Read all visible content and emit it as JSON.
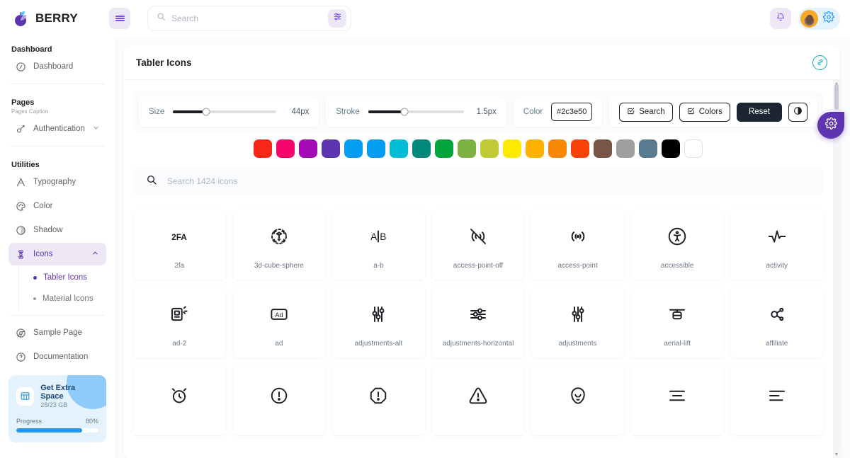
{
  "app": {
    "brand": "BERRY"
  },
  "topbar": {
    "menu_toggle": "menu-toggle",
    "search_placeholder": "Search",
    "search_value": "",
    "filter_label": "filter",
    "notifications_label": "notifications",
    "settings_label": "settings"
  },
  "sidebar": {
    "sections": [
      {
        "caption": "Dashboard",
        "subcaption": ""
      },
      {
        "caption": "Pages",
        "subcaption": "Pages Caption"
      },
      {
        "caption": "Utilities",
        "subcaption": ""
      }
    ],
    "dashboard_item": {
      "label": "Dashboard",
      "icon": "dashboard-icon"
    },
    "authentication_item": {
      "label": "Authentication",
      "icon": "key-icon"
    },
    "utilities": [
      {
        "label": "Typography",
        "icon": "typography-icon"
      },
      {
        "label": "Color",
        "icon": "palette-icon"
      },
      {
        "label": "Shadow",
        "icon": "shadow-icon"
      }
    ],
    "icons_item": {
      "label": "Icons",
      "icon": "icons-icon"
    },
    "icons_children": [
      {
        "label": "Tabler Icons",
        "active": true
      },
      {
        "label": "Material Icons",
        "active": false
      }
    ],
    "footer_items": [
      {
        "label": "Sample Page",
        "icon": "chrome-icon"
      },
      {
        "label": "Documentation",
        "icon": "help-icon"
      }
    ],
    "upsell": {
      "title": "Get Extra Space",
      "subtitle": "28/23 GB",
      "progress_label": "Progress",
      "progress_value": "80%",
      "progress_percent": 80,
      "icon": "table-icon"
    }
  },
  "page": {
    "title": "Tabler Icons",
    "link_icon": "link-icon"
  },
  "toolbar": {
    "size": {
      "label": "Size",
      "value": "44px",
      "percent": 32
    },
    "stroke": {
      "label": "Stroke",
      "value": "1.5px",
      "percent": 38
    },
    "color": {
      "label": "Color",
      "value": "#2c3e50"
    },
    "buttons": [
      {
        "label": "Search",
        "icon": "checkbox-icon",
        "style": "outline"
      },
      {
        "label": "Colors",
        "icon": "checkbox-icon",
        "style": "outline"
      },
      {
        "label": "Reset",
        "icon": "",
        "style": "dark"
      }
    ],
    "contrast_button": {
      "label": "",
      "icon": "contrast-icon"
    }
  },
  "swatches": [
    "#f72717",
    "#f5056a",
    "#a509b5",
    "#5e35b1",
    "#039df4",
    "#039df4",
    "#00bcd4",
    "#00897b",
    "#00a63c",
    "#7cb342",
    "#c0ca33",
    "#fdea00",
    "#ffb300",
    "#f98806",
    "#f94208",
    "#795548",
    "#9e9e9e",
    "#597b91",
    "#000000",
    "#ffffff"
  ],
  "icon_search": {
    "placeholder": "Search 1424 icons",
    "value": "",
    "icon": "search-icon"
  },
  "icon_grid": [
    {
      "name": "2fa",
      "glyph": "2fa"
    },
    {
      "name": "3d-cube-sphere",
      "glyph": "3d-cube-sphere"
    },
    {
      "name": "a-b",
      "glyph": "a-b"
    },
    {
      "name": "access-point-off",
      "glyph": "access-point-off"
    },
    {
      "name": "access-point",
      "glyph": "access-point"
    },
    {
      "name": "accessible",
      "glyph": "accessible"
    },
    {
      "name": "activity",
      "glyph": "activity"
    },
    {
      "name": "ad-2",
      "glyph": "ad-2"
    },
    {
      "name": "ad",
      "glyph": "ad"
    },
    {
      "name": "adjustments-alt",
      "glyph": "adjustments-alt"
    },
    {
      "name": "adjustments-horizontal",
      "glyph": "adjustments-horizontal"
    },
    {
      "name": "adjustments",
      "glyph": "adjustments"
    },
    {
      "name": "aerial-lift",
      "glyph": "aerial-lift"
    },
    {
      "name": "affiliate",
      "glyph": "affiliate"
    },
    {
      "name": "",
      "glyph": "alarm"
    },
    {
      "name": "",
      "glyph": "alert-circle"
    },
    {
      "name": "",
      "glyph": "alert-octagon"
    },
    {
      "name": "",
      "glyph": "alert-triangle"
    },
    {
      "name": "",
      "glyph": "alien"
    },
    {
      "name": "",
      "glyph": "align-center"
    },
    {
      "name": "",
      "glyph": "align-left"
    }
  ],
  "fab": {
    "label": "settings",
    "icon": "gear-icon"
  }
}
